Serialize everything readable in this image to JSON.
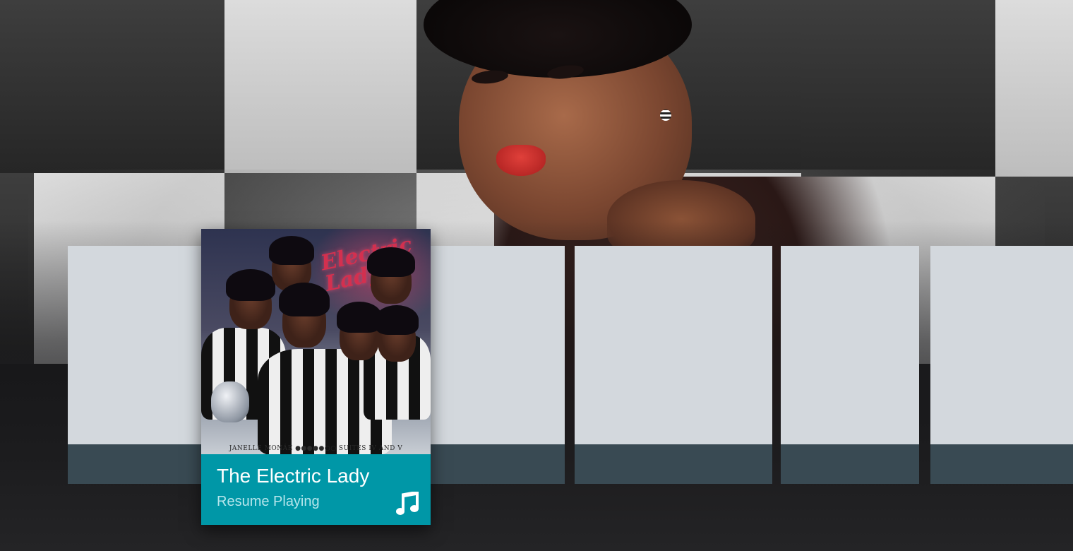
{
  "focused_card": {
    "title": "The Electric Lady",
    "subtitle": "Resume Playing",
    "album_art_script": "Electric Lady",
    "album_art_caption": "JANELLE MONÁE ●●●●●○○ SUITES IV AND V",
    "icon": "music-note-icon"
  },
  "colors": {
    "focus_card_footer": "#0097a7",
    "placeholder_card": "#d3d8dd",
    "placeholder_footer": "#394a53",
    "subtitle_text": "#b6e6ec"
  },
  "placeholder_cards": [
    {
      "name": "card-1"
    },
    {
      "name": "card-2"
    },
    {
      "name": "card-3"
    },
    {
      "name": "card-4"
    },
    {
      "name": "card-5"
    }
  ]
}
